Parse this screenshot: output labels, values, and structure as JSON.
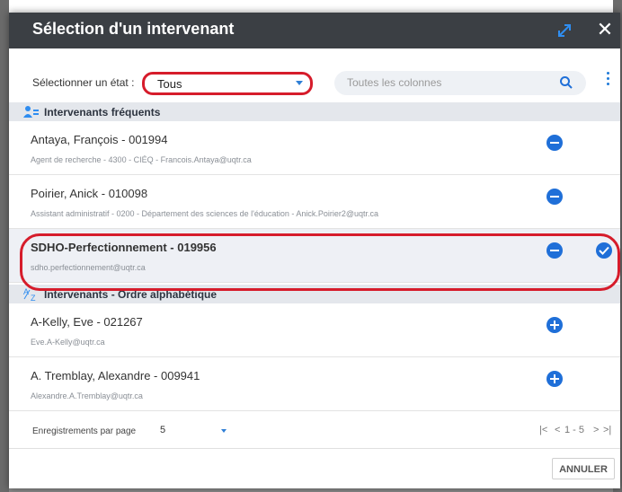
{
  "dialog": {
    "title": "Sélection d'un intervenant"
  },
  "filter": {
    "state_label": "Sélectionner un état :",
    "state_value": "Tous",
    "search_placeholder": "Toutes les colonnes"
  },
  "groups": {
    "frequent": {
      "label": "Intervenants fréquents",
      "rows": [
        {
          "name": "Antaya, François - 001994",
          "detail": "Agent de recherche - 4300 - CIÉQ - Francois.Antaya@uqtr.ca"
        },
        {
          "name": "Poirier, Anick - 010098",
          "detail": "Assistant administratif - 0200 - Département des sciences de l'éducation - Anick.Poirier2@uqtr.ca"
        },
        {
          "name": "SDHO-Perfectionnement - 019956",
          "detail": "sdho.perfectionnement@uqtr.ca"
        }
      ]
    },
    "alpha": {
      "label": "Intervenants - Ordre alphabétique",
      "rows": [
        {
          "name": "A-Kelly, Eve - 021267",
          "detail": "Eve.A-Kelly@uqtr.ca"
        },
        {
          "name": "A. Tremblay, Alexandre - 009941",
          "detail": "Alexandre.A.Tremblay@uqtr.ca"
        }
      ]
    }
  },
  "pagination": {
    "per_page_label": "Enregistrements par page",
    "per_page_value": "5",
    "range": "1 - 5"
  },
  "actions": {
    "cancel_label": "ANNULER"
  },
  "colors": {
    "titlebar": "#3b3f44",
    "accent": "#1f6fd8",
    "highlight": "#d61c2b"
  }
}
